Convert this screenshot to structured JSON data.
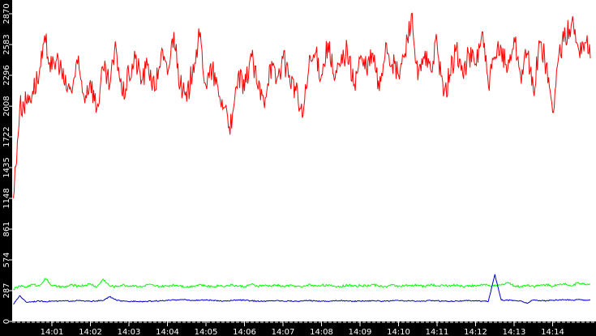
{
  "chart_data": {
    "type": "line",
    "title": "",
    "xlabel": "",
    "ylabel": "",
    "ylim": [
      0,
      2870
    ],
    "xlim_minutes": [
      0,
      15.1
    ],
    "y_ticks": [
      "0",
      "287",
      "574",
      "861",
      "1148",
      "1435",
      "1722",
      "2008",
      "2296",
      "2583",
      "2870"
    ],
    "x_ticks": [
      "14:01",
      "14:02",
      "14:03",
      "14:04",
      "14:05",
      "14:06",
      "14:07",
      "14:08",
      "14:09",
      "14:10",
      "14:11",
      "14:12",
      "14:13",
      "14:14"
    ],
    "sample_interval_seconds": 10,
    "series": [
      {
        "name": "red",
        "color": "#ff0000",
        "values": [
          1150,
          2000,
          2050,
          2150,
          2300,
          2600,
          2350,
          2450,
          2200,
          2150,
          2400,
          2100,
          2250,
          1980,
          2350,
          2200,
          2550,
          2100,
          2300,
          2450,
          2250,
          2400,
          2150,
          2500,
          2300,
          2700,
          2200,
          2050,
          2400,
          2650,
          2200,
          2350,
          2100,
          2000,
          1800,
          2300,
          2150,
          2500,
          2200,
          2050,
          2400,
          2250,
          2450,
          2300,
          2150,
          1900,
          2350,
          2500,
          2300,
          2600,
          2250,
          2400,
          2550,
          2200,
          2450,
          2350,
          2500,
          2150,
          2600,
          2400,
          2300,
          2500,
          2870,
          2250,
          2450,
          2350,
          2600,
          2100,
          2300,
          2550,
          2300,
          2500,
          2400,
          2700,
          2200,
          2450,
          2550,
          2350,
          2650,
          2300,
          2500,
          2150,
          2600,
          2400,
          1950,
          2500,
          2650,
          2800,
          2550,
          2600,
          2550
        ]
      },
      {
        "name": "green",
        "color": "#00ff00",
        "values": [
          300,
          330,
          320,
          345,
          330,
          400,
          335,
          325,
          320,
          340,
          330,
          335,
          350,
          320,
          395,
          330,
          325,
          340,
          330,
          335,
          320,
          345,
          330,
          325,
          330,
          340,
          335,
          320,
          330,
          345,
          330,
          325,
          335,
          330,
          340,
          330,
          325,
          345,
          330,
          335,
          330,
          340,
          325,
          335,
          330,
          320,
          345,
          330,
          340,
          335,
          330,
          325,
          340,
          330,
          335,
          330,
          345,
          330,
          325,
          340,
          330,
          335,
          330,
          340,
          325,
          345,
          330,
          335,
          330,
          340,
          325,
          335,
          330,
          345,
          335,
          330,
          340,
          365,
          330,
          325,
          340,
          330,
          335,
          345,
          330,
          340,
          355,
          330,
          365,
          345,
          350
        ]
      },
      {
        "name": "blue",
        "color": "#0000cc",
        "values": [
          160,
          240,
          180,
          185,
          190,
          185,
          190,
          188,
          192,
          190,
          195,
          190,
          188,
          192,
          195,
          232,
          200,
          188,
          185,
          190,
          186,
          188,
          190,
          192,
          195,
          200,
          205,
          200,
          195,
          198,
          200,
          196,
          190,
          192,
          195,
          200,
          198,
          192,
          190,
          188,
          192,
          195,
          190,
          192,
          188,
          190,
          195,
          192,
          190,
          188,
          192,
          195,
          190,
          188,
          192,
          190,
          195,
          190,
          188,
          192,
          195,
          190,
          192,
          188,
          190,
          195,
          192,
          190,
          188,
          192,
          190,
          195,
          192,
          190,
          188,
          440,
          200,
          198,
          195,
          190,
          170,
          200,
          195,
          192,
          198,
          200,
          202,
          198,
          205,
          200,
          200
        ]
      }
    ]
  }
}
